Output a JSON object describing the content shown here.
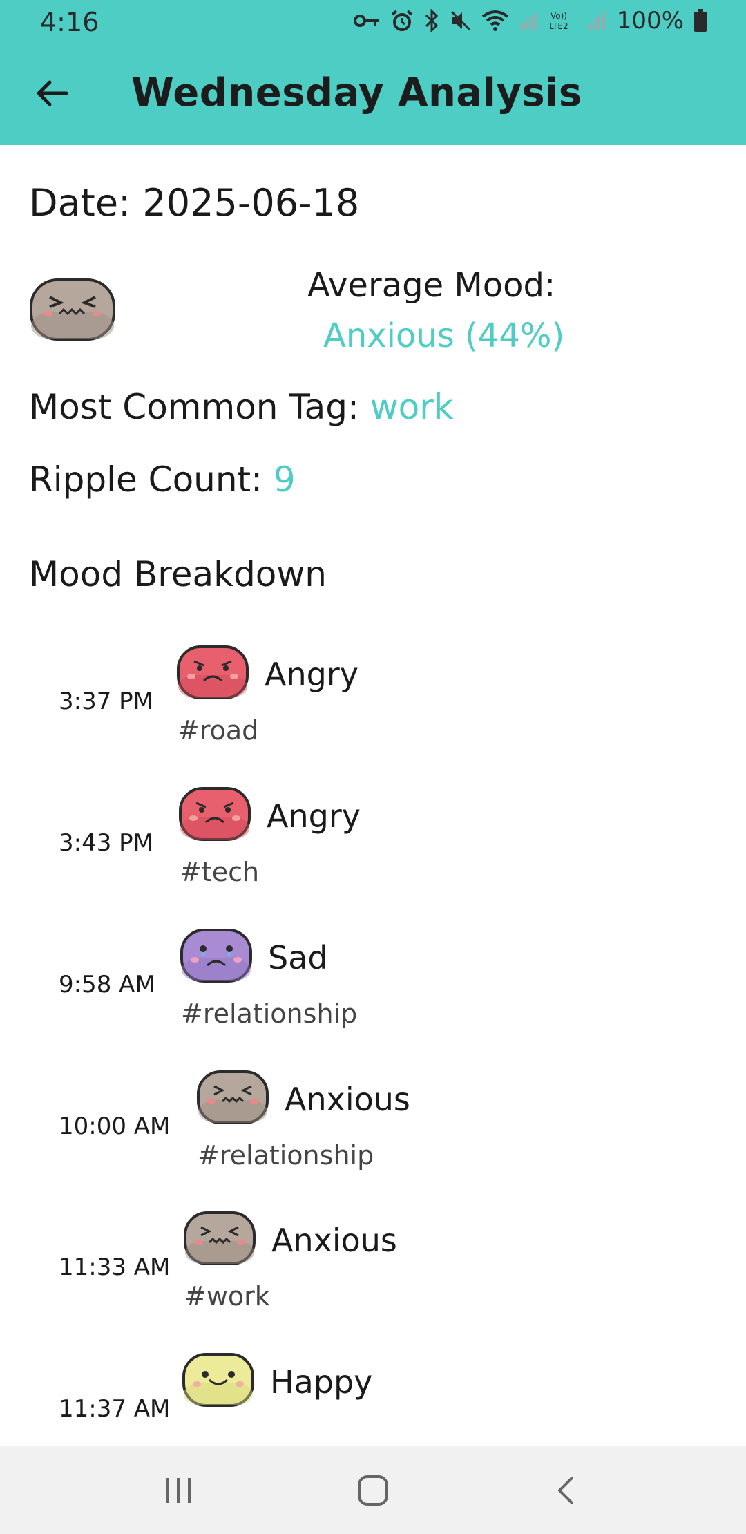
{
  "status_bar": {
    "time": "4:16",
    "battery": "100%"
  },
  "app_bar": {
    "title": "Wednesday Analysis"
  },
  "summary": {
    "date": "Date: 2025-06-18",
    "average_mood_label": "Average Mood:",
    "average_mood_value": "Anxious (44%)",
    "most_common_tag_label": "Most Common Tag: ",
    "most_common_tag_value": "work",
    "ripple_count_label": "Ripple Count: ",
    "ripple_count_value": "9"
  },
  "section_title": "Mood Breakdown",
  "entries": [
    {
      "time": "3:37 PM",
      "mood": "Angry",
      "tag": "#road"
    },
    {
      "time": "3:43 PM",
      "mood": "Angry",
      "tag": "#tech"
    },
    {
      "time": "9:58 AM",
      "mood": "Sad",
      "tag": "#relationship"
    },
    {
      "time": "10:00 AM",
      "mood": "Anxious",
      "tag": "#relationship"
    },
    {
      "time": "11:33 AM",
      "mood": "Anxious",
      "tag": "#work"
    },
    {
      "time": "11:37 AM",
      "mood": "Happy",
      "tag": ""
    }
  ],
  "colors": {
    "accent": "#4ecdc4",
    "angry": "#e8606e",
    "sad": "#a98bd4",
    "anxious": "#b5a79c",
    "happy": "#eceb9a"
  },
  "icons": [
    "back-arrow-icon",
    "vpn-key-icon",
    "alarm-icon",
    "bluetooth-icon",
    "mute-icon",
    "wifi-icon",
    "signal-icon",
    "battery-icon",
    "recent-apps-icon",
    "home-icon",
    "nav-back-icon"
  ]
}
